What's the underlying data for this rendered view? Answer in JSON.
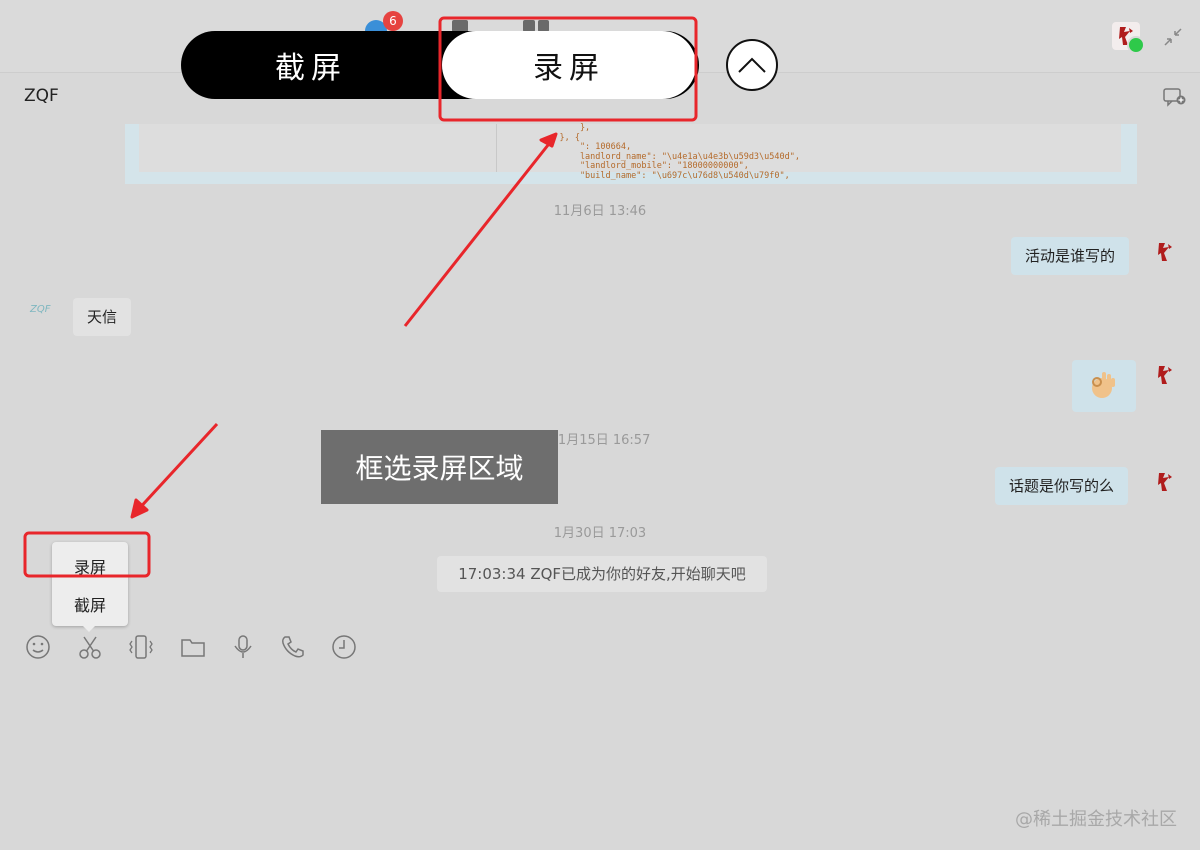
{
  "topbar": {
    "notification_count": "6"
  },
  "capture_toggle": {
    "screenshot_label": "截屏",
    "record_label": "录屏"
  },
  "chat": {
    "title": "ZQF",
    "code_snippet": "        },\n    }, {\n        \": 100664,\n        landlord_name\": \"\\u4e1a\\u4e3b\\u59d3\\u540d\",\n        \"landlord_mobile\": \"18000000000\",\n        \"build_name\": \"\\u697c\\u76d8\\u540d\\u79f0\",",
    "timestamps": [
      "11月6日  13:46",
      "11月15日  16:57",
      "1月30日  17:03"
    ],
    "messages": {
      "outgoing_1": "活动是谁写的",
      "incoming_1": "天信",
      "outgoing_3": "话题是你写的么"
    },
    "contact_avatar_text": "ZQF",
    "system_message": "17:03:34 ZQF已成为你的好友,开始聊天吧"
  },
  "overlay": {
    "region_tip": "框选录屏区域"
  },
  "capture_menu": {
    "record": "录屏",
    "screenshot": "截屏"
  },
  "toolbar": {
    "icons": [
      "emoji-icon",
      "scissors-icon",
      "shake-icon",
      "folder-icon",
      "microphone-icon",
      "phone-icon",
      "clock-icon"
    ]
  },
  "watermark": "@稀土掘金技术社区",
  "colors": {
    "annotation": "#e8262b",
    "status_online": "#2ec94a",
    "badge": "#e64340",
    "bubble_outgoing": "#cfe2ea"
  }
}
